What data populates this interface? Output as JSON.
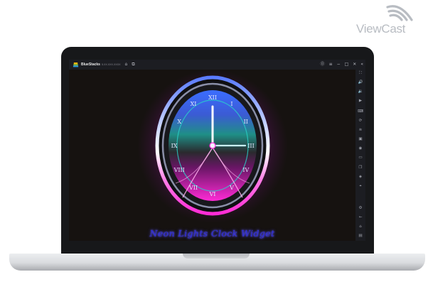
{
  "watermark": {
    "brand": "ViewCast"
  },
  "window": {
    "app_name": "BlueStacks",
    "version": "5.XX.XXX.XXXX",
    "titlebar_icons": [
      "home-icon",
      "multi-instance-icon"
    ],
    "window_controls": [
      "help-icon",
      "menu-icon",
      "minimize-icon",
      "maximize-icon",
      "close-icon",
      "collapse-sidebar-icon"
    ]
  },
  "sidebar": {
    "icons": [
      "fullscreen-icon",
      "volume-up-icon",
      "volume-down-icon",
      "play-icon",
      "keyboard-icon",
      "rotate-icon",
      "shake-icon",
      "screenshot-icon",
      "record-icon",
      "folder-icon",
      "copy-icon",
      "layers-icon",
      "location-icon",
      "settings-icon",
      "back-icon",
      "home-icon",
      "recent-apps-icon"
    ]
  },
  "content": {
    "title": "Neon Lights Clock Widget",
    "clock_numerals": [
      "XII",
      "I",
      "II",
      "III",
      "IV",
      "V",
      "VI",
      "VII",
      "VIII",
      "IX",
      "X",
      "XI"
    ],
    "clock_time": {
      "hour": 12,
      "minute": 15
    },
    "colors": {
      "neon_pink": "#ff2bd6",
      "neon_blue": "#3b6dff",
      "neon_teal": "#2bd2c8",
      "title": "#2f2cd8"
    }
  }
}
